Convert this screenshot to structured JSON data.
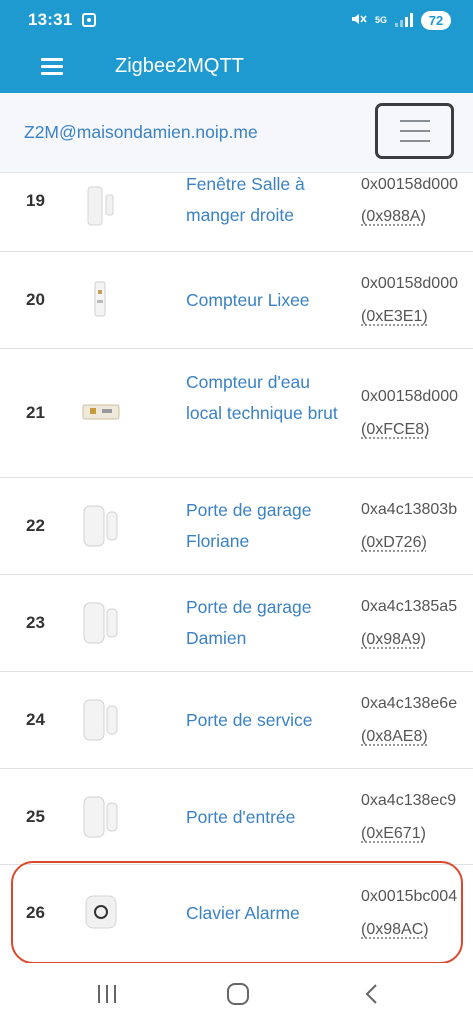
{
  "status_bar": {
    "time": "13:31",
    "network": "5G",
    "battery": "72"
  },
  "app_bar": {
    "title": "Zigbee2MQTT",
    "menu_icon": "hamburger-icon"
  },
  "navbar": {
    "brand": "Z2M@maisondamien.noip.me",
    "toggler_icon": "menu-toggle-icon"
  },
  "devices": [
    {
      "index": "19",
      "name": "Fenêtre Salle à manger droite",
      "ieee": "0x00158d000",
      "nwk": "(0x988A)",
      "thumb": "window-sensor"
    },
    {
      "index": "20",
      "name": "Compteur Lixee",
      "ieee": "0x00158d000",
      "nwk": "(0xE3E1)",
      "thumb": "dongle"
    },
    {
      "index": "21",
      "name": "Compteur d'eau local technique brut",
      "ieee": "0x00158d000",
      "nwk": "(0xFCE8)",
      "thumb": "module"
    },
    {
      "index": "22",
      "name": "Porte de garage Floriane",
      "ieee": "0xa4c13803b",
      "nwk": "(0xD726)",
      "thumb": "door-sensor"
    },
    {
      "index": "23",
      "name": "Porte de garage Damien",
      "ieee": "0xa4c1385a5",
      "nwk": "(0x98A9)",
      "thumb": "door-sensor"
    },
    {
      "index": "24",
      "name": "Porte de service",
      "ieee": "0xa4c138e6e",
      "nwk": "(0x8AE8)",
      "thumb": "door-sensor"
    },
    {
      "index": "25",
      "name": "Porte d'entrée",
      "ieee": "0xa4c138ec9",
      "nwk": "(0xE671)",
      "thumb": "door-sensor"
    },
    {
      "index": "26",
      "name": "Clavier Alarme",
      "ieee": "0x0015bc004",
      "nwk": "(0x98AC)",
      "thumb": "keypad"
    }
  ],
  "bottom_nav": [
    "recent-apps-icon",
    "home-icon",
    "back-icon"
  ],
  "colors": {
    "accent": "#1e9ad0",
    "link": "#3b82c4",
    "highlight": "#d9492c"
  }
}
